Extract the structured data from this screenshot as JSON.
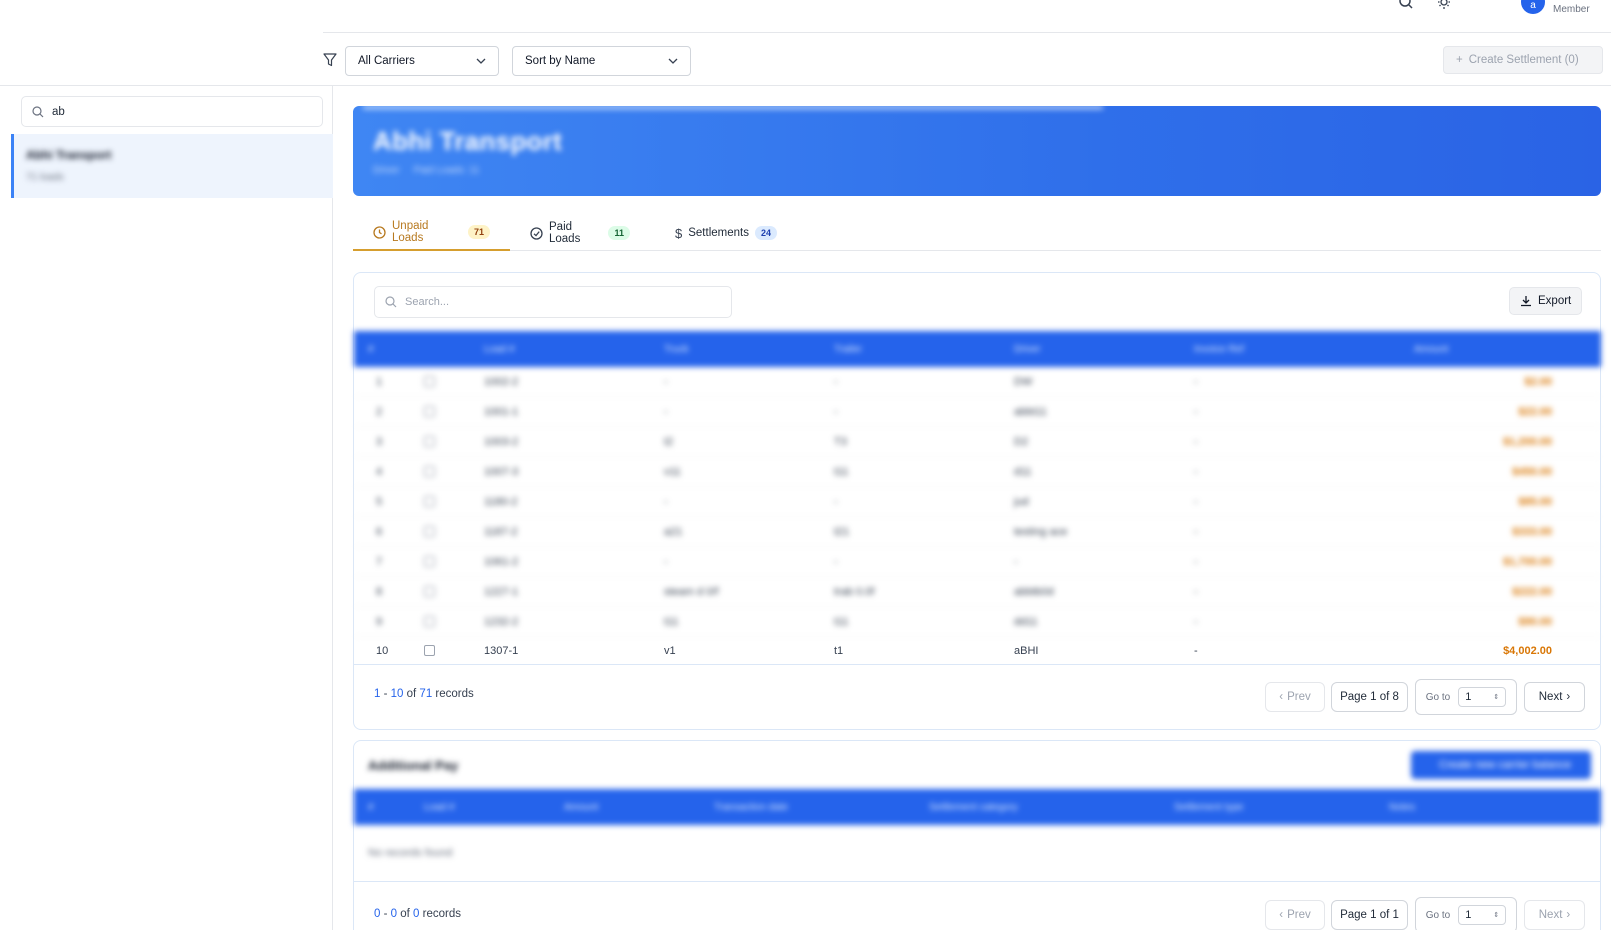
{
  "topbar": {
    "user_initial": "a",
    "user_role": "Member",
    "icons": [
      "search-icon",
      "sun-icon"
    ]
  },
  "filters": {
    "carrier_select": "All Carriers",
    "sort_select": "Sort by Name",
    "create_settlement_label": "Create Settlement (0)"
  },
  "sidebar": {
    "search_value": "ab",
    "items": [
      {
        "name": "Abhi Transport",
        "sub": "71 loads"
      }
    ]
  },
  "banner": {
    "title": "Abhi Transport",
    "sub1": "Driver",
    "sub2": "Paid Loads: 11"
  },
  "tabs": [
    {
      "label": "Unpaid Loads",
      "count": "71",
      "icon": "clock-icon"
    },
    {
      "label": "Paid Loads",
      "count": "11",
      "icon": "check-circle-icon"
    },
    {
      "label": "Settlements",
      "count": "24",
      "icon": "dollar-icon"
    }
  ],
  "loads_table": {
    "search_placeholder": "Search...",
    "export_label": "Export",
    "columns": [
      "#",
      "Load #",
      "Truck",
      "Trailer",
      "Driver",
      "Invoice Ref",
      "Amount"
    ],
    "rows": [
      {
        "n": "1",
        "load": "1002-2",
        "truck": "-",
        "trailer": "-",
        "driver": "DW",
        "invoice": "-",
        "amount": "$2.00"
      },
      {
        "n": "2",
        "load": "1001-1",
        "truck": "-",
        "trailer": "-",
        "driver": "abbt11",
        "invoice": "-",
        "amount": "$22.00"
      },
      {
        "n": "3",
        "load": "1003-2",
        "truck": "t2",
        "trailer": "T3",
        "driver": "D2",
        "invoice": "-",
        "amount": "$1,200.00"
      },
      {
        "n": "4",
        "load": "1007-3",
        "truck": "v11",
        "trailer": "t11",
        "driver": "d11",
        "invoice": "-",
        "amount": "$450.00"
      },
      {
        "n": "5",
        "load": "1180-2",
        "truck": "-",
        "trailer": "-",
        "driver": "jud",
        "invoice": "-",
        "amount": "$85.00"
      },
      {
        "n": "6",
        "load": "1187-2",
        "truck": "a21",
        "trailer": "t21",
        "driver": "testing ace",
        "invoice": "-",
        "amount": "$333.00"
      },
      {
        "n": "7",
        "load": "1061-2",
        "truck": "-",
        "trailer": "-",
        "driver": "-",
        "invoice": "-",
        "amount": "$1,700.00"
      },
      {
        "n": "8",
        "load": "1227-1",
        "truck": "steam d 0/f",
        "trailer": "trab 0.0f",
        "driver": "abbtb0d",
        "invoice": "-",
        "amount": "$222.00"
      },
      {
        "n": "9",
        "load": "1232-2",
        "truck": "t11",
        "trailer": "t11",
        "driver": "dd11",
        "invoice": "-",
        "amount": "$90.00"
      },
      {
        "n": "10",
        "load": "1307-1",
        "truck": "v1",
        "trailer": "t1",
        "driver": "aBHI",
        "invoice": "-",
        "amount": "$4,002.00"
      }
    ],
    "records": {
      "from": "1",
      "to": "10",
      "total": "71",
      "suffix": "records"
    },
    "pager": {
      "prev": "Prev",
      "page": "Page 1 of 8",
      "goto_label": "Go to",
      "goto_value": "1",
      "next": "Next"
    }
  },
  "additional_pay": {
    "title": "Additional Pay",
    "create_label": "Create new carrier balance",
    "columns": [
      "#",
      "Load #",
      "Amount",
      "Transaction date",
      "Settlement category",
      "Settlement type",
      "Notes"
    ],
    "empty_text": "No records found",
    "records": {
      "from": "0",
      "to": "0",
      "total": "0",
      "suffix": "records"
    },
    "pager": {
      "prev": "Prev",
      "page": "Page 1 of 1",
      "goto_label": "Go to",
      "goto_value": "1",
      "next": "Next"
    }
  },
  "colors": {
    "brand_blue": "#2563eb",
    "amount_orange": "#d97706",
    "tab_active": "#b7791f"
  }
}
